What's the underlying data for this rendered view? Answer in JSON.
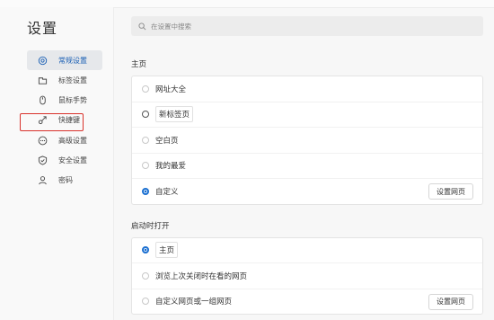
{
  "app": {
    "title": "设置"
  },
  "search": {
    "placeholder": "在设置中搜索"
  },
  "sidebar": {
    "items": [
      {
        "label": "常规设置",
        "icon": "settings-gear-icon",
        "active": true
      },
      {
        "label": "标签设置",
        "icon": "tab-icon",
        "active": false
      },
      {
        "label": "鼠标手势",
        "icon": "mouse-gesture-icon",
        "active": false
      },
      {
        "label": "快捷键",
        "icon": "shortcut-arrow-icon",
        "active": false
      },
      {
        "label": "高级设置",
        "icon": "more-dots-icon",
        "active": false
      },
      {
        "label": "安全设置",
        "icon": "shield-icon",
        "active": false
      },
      {
        "label": "密码",
        "icon": "user-icon",
        "active": false
      }
    ]
  },
  "homepage": {
    "title": "主页",
    "options": [
      {
        "label": "网址大全",
        "checked": false
      },
      {
        "label": "新标签页",
        "checked": false
      },
      {
        "label": "空白页",
        "checked": false
      },
      {
        "label": "我的最爱",
        "checked": false
      },
      {
        "label": "自定义",
        "checked": true,
        "button": "设置网页"
      }
    ]
  },
  "startup": {
    "title": "启动时打开",
    "options": [
      {
        "label": "主页",
        "checked": true
      },
      {
        "label": "浏览上次关闭时在看的网页",
        "checked": false
      },
      {
        "label": "自定义网页或一组网页",
        "checked": false,
        "button": "设置网页"
      }
    ]
  },
  "colors": {
    "accent": "#1a6fd1",
    "highlight": "#d9322b"
  }
}
